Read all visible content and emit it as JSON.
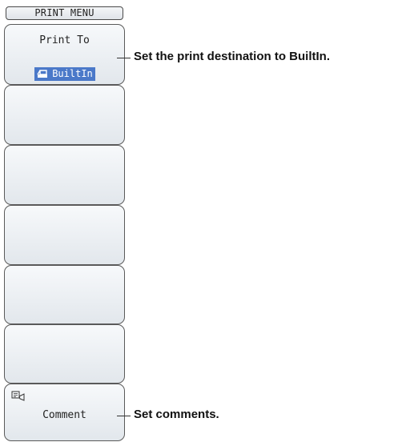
{
  "menu": {
    "title": "PRINT MENU",
    "keys": [
      {
        "label": "Print To",
        "value": "BuiltIn",
        "value_icon": "printer-icon"
      },
      {
        "label": ""
      },
      {
        "label": ""
      },
      {
        "label": ""
      },
      {
        "label": ""
      },
      {
        "label": ""
      },
      {
        "label": "Comment",
        "icon": "comment-icon"
      }
    ]
  },
  "callouts": {
    "print_to": "Set the print destination to BuiltIn.",
    "comment": "Set comments."
  },
  "colors": {
    "value_highlight": "#4b79c9",
    "key_border": "#5a5a5a",
    "key_fill": "#eef1f4"
  }
}
